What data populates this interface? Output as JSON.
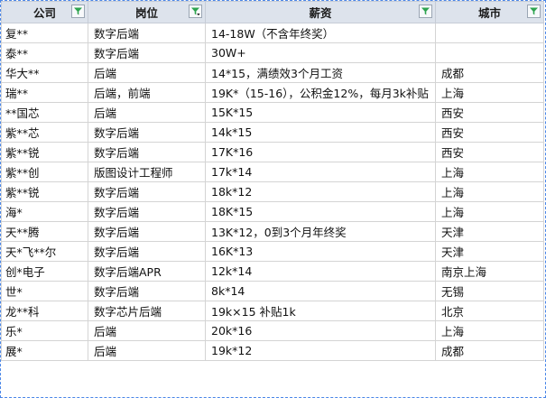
{
  "headers": [
    {
      "label": "公司",
      "filter_icon": "filter-icon",
      "filter_active": false
    },
    {
      "label": "岗位",
      "filter_icon": "filter-active-icon",
      "filter_active": true
    },
    {
      "label": "薪资",
      "filter_icon": "filter-icon",
      "filter_active": false
    },
    {
      "label": "城市",
      "filter_icon": "filter-icon",
      "filter_active": false
    }
  ],
  "rows": [
    [
      "复**",
      "数字后端",
      "14-18W（不含年终奖）",
      ""
    ],
    [
      "泰**",
      "数字后端",
      "30W+",
      ""
    ],
    [
      "华大**",
      "后端",
      "14*15，满绩效3个月工资",
      "成都"
    ],
    [
      "瑞**",
      "后端，前端",
      "19K*（15-16），公积金12%，每月3k补贴",
      "上海"
    ],
    [
      "**国芯",
      "后端",
      "15K*15",
      "西安"
    ],
    [
      "紫**芯",
      "数字后端",
      "14k*15",
      "西安"
    ],
    [
      "紫**锐",
      "数字后端",
      "17K*16",
      "西安"
    ],
    [
      "紫**创",
      "版图设计工程师",
      "17k*14",
      "上海"
    ],
    [
      "紫**锐",
      "数字后端",
      "18k*12",
      "上海"
    ],
    [
      "海*",
      "数字后端",
      "18K*15",
      "上海"
    ],
    [
      "天**腾",
      "数字后端",
      "13K*12，0到3个月年终奖",
      "天津"
    ],
    [
      "天*飞**尔",
      "数字后端",
      "16K*13",
      "天津"
    ],
    [
      "创*电子",
      "数字后端APR",
      "12k*14",
      "南京上海"
    ],
    [
      "世*",
      "数字后端",
      "8k*14",
      "无锡"
    ],
    [
      "龙**科",
      "数字芯片后端",
      "19k×15  补贴1k",
      "北京"
    ],
    [
      "乐*",
      "后端",
      "20k*16",
      "上海"
    ],
    [
      "展*",
      "后端",
      "19k*12",
      "成都"
    ]
  ],
  "colors": {
    "header_bg": "#dde3ec",
    "filter_icon": "#2ea44f",
    "selection_border": "#4a86e8"
  }
}
